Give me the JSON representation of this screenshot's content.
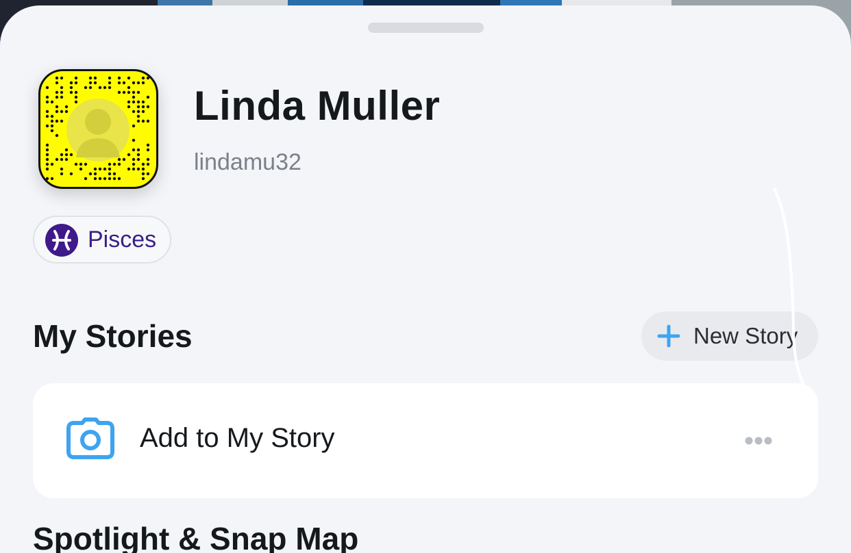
{
  "profile": {
    "display_name": "Linda Muller",
    "username": "lindamu32",
    "snapcode_icon": "snapcode-icon",
    "zodiac": {
      "label": "Pisces",
      "icon": "pisces-icon",
      "color": "#3f1a8a"
    }
  },
  "stories": {
    "title": "My Stories",
    "new_story_label": "New Story",
    "new_story_icon": "plus-icon",
    "add_to_story_label": "Add to My Story",
    "add_to_story_icon": "camera-icon",
    "more_icon": "ellipsis-icon"
  },
  "next_section": {
    "title": "Spotlight & Snap Map"
  },
  "colors": {
    "accent_blue": "#3ea4f0",
    "snapcode_yellow": "#fffc00",
    "sheet_bg": "#f4f5f8"
  }
}
